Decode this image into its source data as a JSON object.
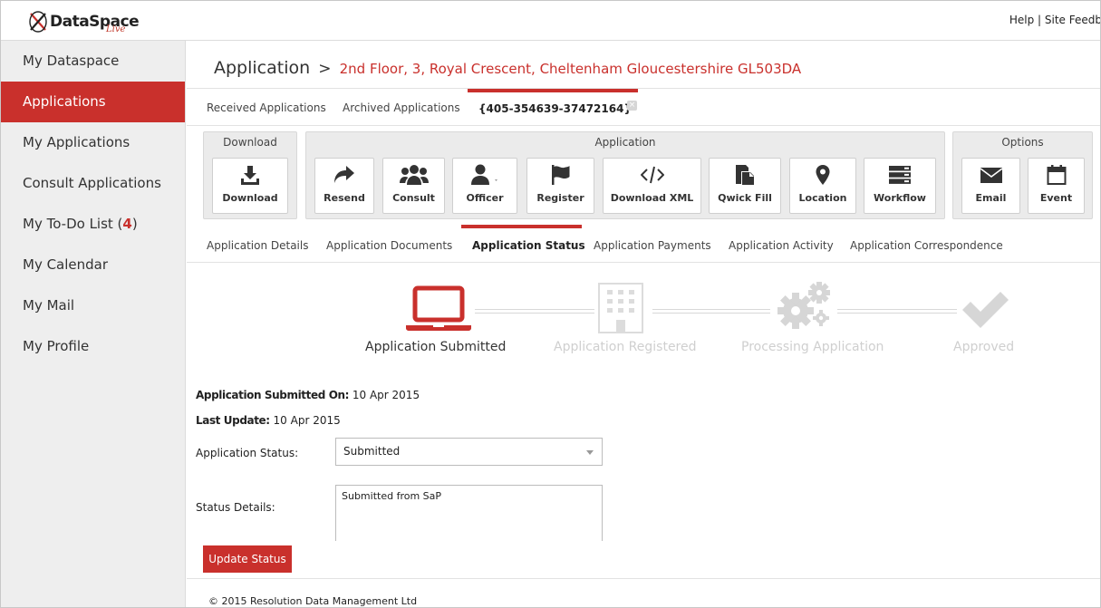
{
  "app": {
    "logo_text": "DataSpace",
    "logo_sub": "Live",
    "top_links": {
      "help": "Help",
      "separator": "|",
      "feedback": "Site Feedb"
    }
  },
  "sidebar": {
    "items": [
      {
        "label": "My Dataspace",
        "active": false
      },
      {
        "label": "Applications",
        "active": true
      },
      {
        "label": "My Applications",
        "active": false
      },
      {
        "label": "Consult Applications",
        "active": false
      },
      {
        "label": "My To-Do List (",
        "count": "4",
        "suffix": ")",
        "active": false
      },
      {
        "label": "My Calendar",
        "active": false
      },
      {
        "label": "My Mail",
        "active": false
      },
      {
        "label": "My Profile",
        "active": false
      }
    ]
  },
  "breadcrumb": {
    "root": "Application",
    "separator": ">",
    "address": "2nd Floor, 3, Royal Crescent, Cheltenham Gloucestershire GL503DA"
  },
  "top_tabs": [
    {
      "label": "Received Applications",
      "active": false
    },
    {
      "label": "Archived Applications",
      "active": false
    },
    {
      "label": "{405-354639-37472164}",
      "active": true,
      "close": "×"
    }
  ],
  "toolbar": {
    "download_group": {
      "title": "Download",
      "buttons": [
        {
          "label": "Download",
          "icon": "download-icon"
        }
      ]
    },
    "application_group": {
      "title": "Application",
      "buttons": [
        {
          "label": "Resend",
          "icon": "share-icon"
        },
        {
          "label": "Consult",
          "icon": "users-icon"
        },
        {
          "label": "Officer",
          "icon": "user-icon"
        },
        {
          "label": "Register",
          "icon": "flag-icon"
        },
        {
          "label": "Download XML",
          "icon": "code-icon"
        },
        {
          "label": "Qwick Fill",
          "icon": "copy-icon"
        },
        {
          "label": "Location",
          "icon": "map-marker-icon"
        },
        {
          "label": "Workflow",
          "icon": "server-icon"
        }
      ]
    },
    "options_group": {
      "title": "Options",
      "buttons": [
        {
          "label": "Email",
          "icon": "envelope-icon"
        },
        {
          "label": "Event",
          "icon": "calendar-icon"
        }
      ]
    }
  },
  "sub_tabs": [
    {
      "label": "Application Details",
      "active": false
    },
    {
      "label": "Application Documents",
      "active": false
    },
    {
      "label": "Application Status",
      "active": true
    },
    {
      "label": "Application Payments",
      "active": false
    },
    {
      "label": "Application Activity",
      "active": false
    },
    {
      "label": "Application Correspondence",
      "active": false
    }
  ],
  "steps": [
    {
      "label": "Application Submitted",
      "icon": "laptop-icon",
      "done": true
    },
    {
      "label": "Application Registered",
      "icon": "building-icon",
      "done": false
    },
    {
      "label": "Processing Application",
      "icon": "gears-icon",
      "done": false
    },
    {
      "label": "Approved",
      "icon": "checkmark-icon",
      "done": false
    }
  ],
  "colors": {
    "accent": "#c9302c",
    "step_inactive": "#d6d6d6",
    "sidebar_bg": "#eeeeee"
  },
  "status": {
    "submitted_on_label": "Application Submitted On:",
    "submitted_on_value": "10 Apr 2015",
    "last_update_label": "Last Update:",
    "last_update_value": "10 Apr 2015",
    "status_label": "Application Status:",
    "status_value": "Submitted",
    "details_label": "Status Details:",
    "details_value": "Submitted from SaP",
    "update_button": "Update Status"
  },
  "footer": {
    "copyright": "© 2015 Resolution Data Management Ltd"
  }
}
